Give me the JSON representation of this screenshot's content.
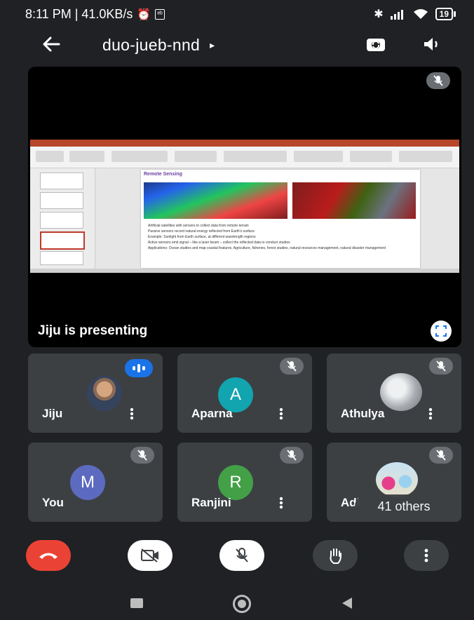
{
  "status_bar": {
    "time_and_speed": "8:11 PM | 41.0KB/s",
    "alarm_icon": "alarm-icon",
    "notification_badge": "ᵉᵇ",
    "bluetooth_icon": "bluetooth-icon",
    "signal_icon": "signal-icon",
    "wifi_icon": "wifi-icon",
    "battery": "19"
  },
  "top_bar": {
    "meeting_code": "duo-jueb-nnd",
    "caret": "▸"
  },
  "presentation": {
    "slide_title": "Remote Sensing",
    "bullets": [
      "Artificial satellites with sensors to collect data from remote terrain",
      "Passive sensors record natural energy reflected from Earth's surface",
      "Example: Sunlight from Earth surface, at different wavelength regions",
      "Active sensors emit signal – like a laser beam – collect the reflected data to conduct studies",
      "Applications: Ocean studies and map coastal features, Agriculture, fisheries, forest studies, natural resources management, natural disaster management"
    ],
    "presenter_text": "Jiju is presenting"
  },
  "participants": [
    {
      "name": "Jiju",
      "state": "speaking"
    },
    {
      "name": "Aparna",
      "initial": "A",
      "color": "#12a4af",
      "state": "muted"
    },
    {
      "name": "Athulya",
      "state": "muted"
    },
    {
      "name": "You",
      "initial": "M",
      "color": "#5c6bc0",
      "state": "muted"
    },
    {
      "name": "Ranjini",
      "initial": "R",
      "color": "#43a047",
      "state": "muted"
    },
    {
      "name": "Adi",
      "state": "muted"
    }
  ],
  "others_label": "41 others",
  "controls": {
    "end_call": "end-call-icon",
    "camera": "camera-off-icon",
    "mic": "mic-off-icon",
    "raise_hand": "hand-icon",
    "more": "more-vert-icon"
  },
  "colors": {
    "background": "#202124",
    "tile": "#3c4043",
    "end_call": "#ea4335",
    "speaking": "#1a73e8"
  }
}
